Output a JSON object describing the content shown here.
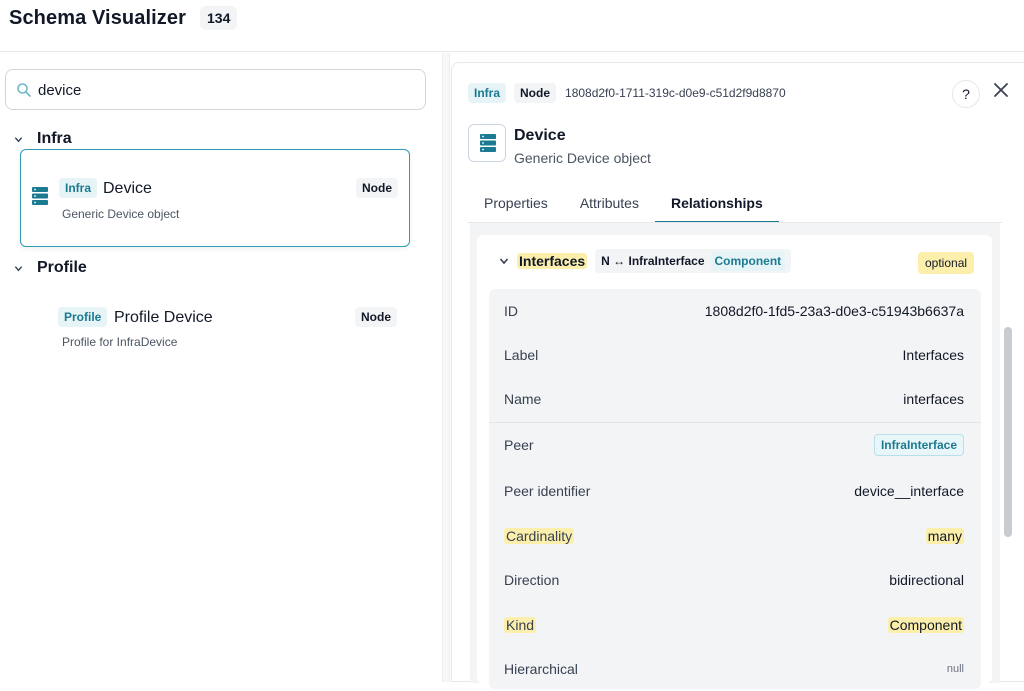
{
  "app": {
    "title": "Schema Visualizer",
    "count": "134"
  },
  "search": {
    "value": "device",
    "placeholder": ""
  },
  "groups": [
    {
      "label": "Infra",
      "items": [
        {
          "namespace": "Infra",
          "title": "Device",
          "description": "Generic Device object",
          "kind": "Node",
          "selected": true
        }
      ]
    },
    {
      "label": "Profile",
      "items": [
        {
          "namespace": "Profile",
          "title": "Profile Device",
          "description": "Profile for InfraDevice",
          "kind": "Node",
          "selected": false
        }
      ]
    }
  ],
  "detail": {
    "namespace": "Infra",
    "kind": "Node",
    "id": "1808d2f0-1711-319c-d0e9-c51d2f9d8870",
    "help_label": "?",
    "title": "Device",
    "description": "Generic Device object",
    "tabs": [
      {
        "label": "Properties",
        "active": false
      },
      {
        "label": "Attributes",
        "active": false
      },
      {
        "label": "Relationships",
        "active": true
      }
    ],
    "relationship": {
      "name": "Interfaces",
      "cardinality_badge": "N ↔ InfraInterface",
      "kind_badge": "Component",
      "optional_label": "optional",
      "rows": [
        {
          "key": "ID",
          "value": "1808d2f0-1fd5-23a3-d0e3-c51943b6637a"
        },
        {
          "key": "Label",
          "value": "Interfaces"
        },
        {
          "key": "Name",
          "value": "interfaces"
        },
        {
          "key": "Peer",
          "value": "InfraInterface"
        },
        {
          "key": "Peer identifier",
          "value": "device__interface"
        },
        {
          "key": "Cardinality",
          "value": "many"
        },
        {
          "key": "Direction",
          "value": "bidirectional"
        },
        {
          "key": "Kind",
          "value": "Component"
        },
        {
          "key": "Hierarchical",
          "value": "null"
        }
      ]
    }
  },
  "colors": {
    "accent": "#1b7a91",
    "highlight": "#fcefab",
    "selected_border": "#2f9bb3"
  }
}
